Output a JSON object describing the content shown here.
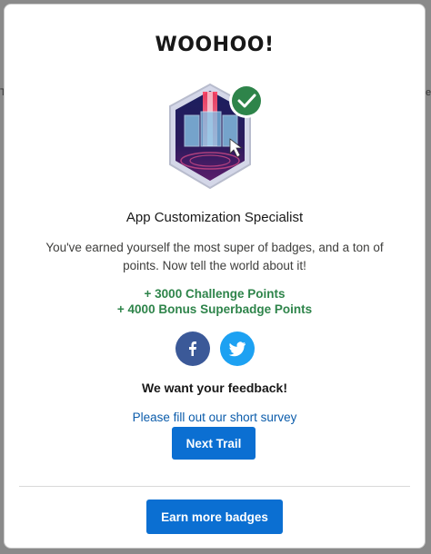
{
  "modal": {
    "title": "WOOHOO!",
    "badge_icon": "superbadge-app-customization-icon",
    "badge_name": "App Customization Specialist",
    "description": "You've earned yourself the most super of badges, and a ton of points. Now tell the world about it!",
    "points": [
      "+ 3000 Challenge Points",
      "+ 4000 Bonus Superbadge Points"
    ],
    "social": {
      "facebook_icon": "facebook-icon",
      "twitter_icon": "twitter-icon"
    },
    "feedback_heading": "We want your feedback!",
    "survey_link": "Please fill out our short survey",
    "next_trail_label": "Next Trail",
    "earn_more_label": "Earn more badges"
  },
  "colors": {
    "accent": "#0b6fd2",
    "points_green": "#2e844a",
    "link_blue": "#0b5cab",
    "facebook": "#3b5998",
    "twitter": "#1da1f2",
    "check_green": "#2e844a"
  }
}
